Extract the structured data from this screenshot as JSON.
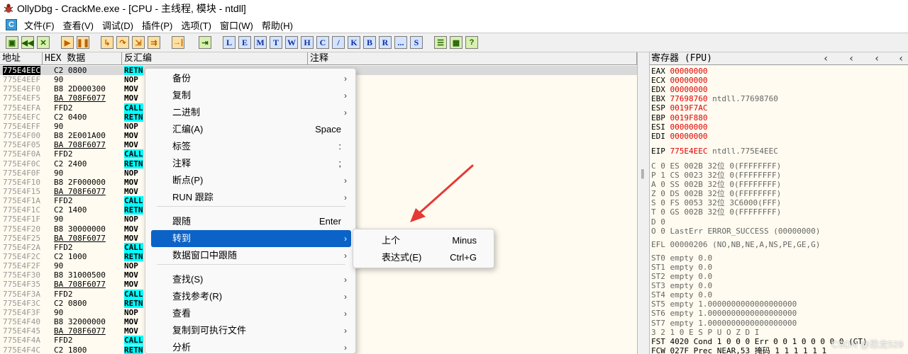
{
  "window": {
    "title": "OllyDbg - CrackMe.exe - [CPU - 主线程, 模块 - ntdll]"
  },
  "menubar": {
    "cpu_label": "C",
    "items": [
      "文件(F)",
      "查看(V)",
      "调试(D)",
      "插件(P)",
      "选项(T)",
      "窗口(W)",
      "帮助(H)"
    ]
  },
  "toolbar": {
    "letters": [
      "L",
      "E",
      "M",
      "T",
      "W",
      "H",
      "C",
      "/",
      "K",
      "B",
      "R",
      "...",
      "S"
    ]
  },
  "cpu": {
    "headers": {
      "address": "地址",
      "hex": "HEX 数据",
      "disasm": "反汇编",
      "comment": "注释"
    },
    "rows": [
      {
        "addr": "775E4EEC",
        "hex": "C2 0800",
        "op": "RETN",
        "kind": "ret"
      },
      {
        "addr": "775E4EEF",
        "hex": "90",
        "op": "NOP",
        "kind": ""
      },
      {
        "addr": "775E4EF0",
        "hex": "B8 2D000300",
        "op": "MOV",
        "kind": ""
      },
      {
        "addr": "775E4EF5",
        "hex": "BA 708F6077",
        "op": "MOV",
        "kind": "",
        "u": true
      },
      {
        "addr": "775E4EFA",
        "hex": "FFD2",
        "op": "CALL",
        "kind": "call"
      },
      {
        "addr": "775E4EFC",
        "hex": "C2 0400",
        "op": "RETN",
        "kind": "ret"
      },
      {
        "addr": "775E4EFF",
        "hex": "90",
        "op": "NOP",
        "kind": ""
      },
      {
        "addr": "775E4F00",
        "hex": "B8 2E001A00",
        "op": "MOV",
        "kind": ""
      },
      {
        "addr": "775E4F05",
        "hex": "BA 708F6077",
        "op": "MOV",
        "kind": "",
        "u": true
      },
      {
        "addr": "775E4F0A",
        "hex": "FFD2",
        "op": "CALL",
        "kind": "call"
      },
      {
        "addr": "775E4F0C",
        "hex": "C2 2400",
        "op": "RETN",
        "kind": "ret"
      },
      {
        "addr": "775E4F0F",
        "hex": "90",
        "op": "NOP",
        "kind": ""
      },
      {
        "addr": "775E4F10",
        "hex": "B8 2F000000",
        "op": "MOV",
        "kind": ""
      },
      {
        "addr": "775E4F15",
        "hex": "BA 708F6077",
        "op": "MOV",
        "kind": "",
        "u": true
      },
      {
        "addr": "775E4F1A",
        "hex": "FFD2",
        "op": "CALL",
        "kind": "call"
      },
      {
        "addr": "775E4F1C",
        "hex": "C2 1400",
        "op": "RETN",
        "kind": "ret"
      },
      {
        "addr": "775E4F1F",
        "hex": "90",
        "op": "NOP",
        "kind": ""
      },
      {
        "addr": "775E4F20",
        "hex": "B8 30000000",
        "op": "MOV",
        "kind": ""
      },
      {
        "addr": "775E4F25",
        "hex": "BA 708F6077",
        "op": "MOV",
        "kind": "",
        "u": true
      },
      {
        "addr": "775E4F2A",
        "hex": "FFD2",
        "op": "CALL",
        "kind": "call"
      },
      {
        "addr": "775E4F2C",
        "hex": "C2 1000",
        "op": "RETN",
        "kind": "ret"
      },
      {
        "addr": "775E4F2F",
        "hex": "90",
        "op": "NOP",
        "kind": ""
      },
      {
        "addr": "775E4F30",
        "hex": "B8 31000500",
        "op": "MOV",
        "kind": ""
      },
      {
        "addr": "775E4F35",
        "hex": "BA 708F6077",
        "op": "MOV",
        "kind": "",
        "u": true
      },
      {
        "addr": "775E4F3A",
        "hex": "FFD2",
        "op": "CALL",
        "kind": "call"
      },
      {
        "addr": "775E4F3C",
        "hex": "C2 0800",
        "op": "RETN",
        "kind": "ret"
      },
      {
        "addr": "775E4F3F",
        "hex": "90",
        "op": "NOP",
        "kind": ""
      },
      {
        "addr": "775E4F40",
        "hex": "B8 32000000",
        "op": "MOV",
        "kind": ""
      },
      {
        "addr": "775E4F45",
        "hex": "BA 708F6077",
        "op": "MOV",
        "kind": "",
        "u": true
      },
      {
        "addr": "775E4F4A",
        "hex": "FFD2",
        "op": "CALL",
        "kind": "call"
      },
      {
        "addr": "775E4F4C",
        "hex": "C2 1800",
        "op": "RETN",
        "kind": "ret"
      }
    ]
  },
  "registers": {
    "header": "寄存器 (FPU)",
    "gp": [
      {
        "name": "EAX",
        "val": "00000000",
        "note": ""
      },
      {
        "name": "ECX",
        "val": "00000000",
        "note": ""
      },
      {
        "name": "EDX",
        "val": "00000000",
        "note": ""
      },
      {
        "name": "EBX",
        "val": "77698760",
        "note": "ntdll.77698760"
      },
      {
        "name": "ESP",
        "val": "0019F7AC",
        "note": ""
      },
      {
        "name": "EBP",
        "val": "0019F880",
        "note": ""
      },
      {
        "name": "ESI",
        "val": "00000000",
        "note": ""
      },
      {
        "name": "EDI",
        "val": "00000000",
        "note": ""
      }
    ],
    "eip": {
      "name": "EIP",
      "val": "775E4EEC",
      "note": "ntdll.775E4EEC"
    },
    "flags": [
      {
        "flag": "C 0",
        "seg": "ES 002B 32位 0(FFFFFFFF)"
      },
      {
        "flag": "P 1",
        "seg": "CS 0023 32位 0(FFFFFFFF)"
      },
      {
        "flag": "A 0",
        "seg": "SS 002B 32位 0(FFFFFFFF)"
      },
      {
        "flag": "Z 0",
        "seg": "DS 002B 32位 0(FFFFFFFF)"
      },
      {
        "flag": "S 0",
        "seg": "FS 0053 32位 3C6000(FFF)"
      },
      {
        "flag": "T 0",
        "seg": "GS 002B 32位 0(FFFFFFFF)"
      },
      {
        "flag": "D 0",
        "seg": ""
      },
      {
        "flag": "O 0",
        "seg": "LastErr ERROR_SUCCESS (00000000)"
      }
    ],
    "efl": "EFL 00000206 (NO,NB,NE,A,NS,PE,GE,G)",
    "fpu": [
      "ST0 empty 0.0",
      "ST1 empty 0.0",
      "ST2 empty 0.0",
      "ST3 empty 0.0",
      "ST4 empty 0.0",
      "ST5 empty 1.0000000000000000000",
      "ST6 empty 1.0000000000000000000",
      "ST7 empty 1.0000000000000000000"
    ],
    "fpu_bits_header": "3 2 1 0      E S P U O Z D I",
    "fst": "FST 4020  Cond 1 0 0 0  Err 0 0 1 0 0 0 0 0  (GT)",
    "fcw": "FCW 027F  Prec NEAR,53  掩码    1 1 1 1 1 1"
  },
  "context_menu": {
    "items": [
      {
        "label": "备份",
        "shortcut": "",
        "arrow": true
      },
      {
        "label": "复制",
        "shortcut": "",
        "arrow": true
      },
      {
        "label": "二进制",
        "shortcut": "",
        "arrow": true
      },
      {
        "label": "汇编(A)",
        "shortcut": "Space",
        "arrow": false
      },
      {
        "label": "标签",
        "shortcut": ":",
        "arrow": false
      },
      {
        "label": "注释",
        "shortcut": ";",
        "arrow": false
      },
      {
        "label": "断点(P)",
        "shortcut": "",
        "arrow": true
      },
      {
        "label": "RUN 跟踪",
        "shortcut": "",
        "arrow": true
      },
      {
        "label": "跟随",
        "shortcut": "Enter",
        "arrow": false
      },
      {
        "label": "转到",
        "shortcut": "",
        "arrow": true
      },
      {
        "label": "数据窗口中跟随",
        "shortcut": "",
        "arrow": true
      },
      {
        "label": "查找(S)",
        "shortcut": "",
        "arrow": true
      },
      {
        "label": "查找参考(R)",
        "shortcut": "",
        "arrow": true
      },
      {
        "label": "查看",
        "shortcut": "",
        "arrow": true
      },
      {
        "label": "复制到可执行文件",
        "shortcut": "",
        "arrow": true
      },
      {
        "label": "分析",
        "shortcut": "",
        "arrow": true
      }
    ]
  },
  "submenu": {
    "items": [
      {
        "label": "上个",
        "shortcut": "Minus"
      },
      {
        "label": "表达式(E)",
        "shortcut": "Ctrl+G"
      }
    ]
  },
  "watermark": "CSDN @恐龙529",
  "colors": {
    "highlight": "#0b63c8",
    "accent_red": "#e00000",
    "cyan": "#00ffff",
    "arrow": "#e53935"
  }
}
